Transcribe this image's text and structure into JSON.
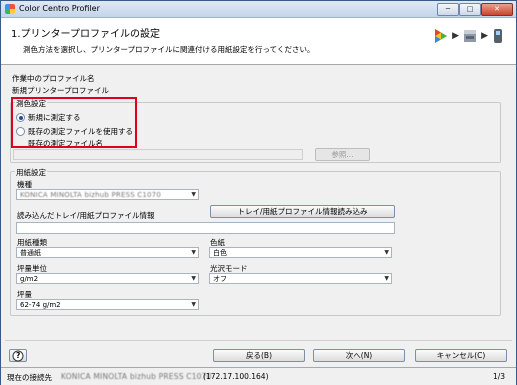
{
  "window": {
    "title": "Color Centro Profiler",
    "buttons": [
      "─",
      "□",
      "✕"
    ]
  },
  "header": {
    "title": "1.プリンタープロファイルの設定",
    "description": "測色方法を選択し、プリンタープロファイルに関連付ける用紙設定を行ってください。"
  },
  "profile": {
    "label": "作業中のプロファイル名",
    "name": "新規プリンタープロファイル"
  },
  "measure": {
    "title": "測色設定",
    "option_new": "新規に測定する",
    "option_existing": "既存の測定ファイルを使用する",
    "file_label": "既存の測定ファイル名",
    "file_value": "",
    "browse_label": "参照..."
  },
  "paper": {
    "title": "用紙設定",
    "model_label": "機種",
    "model_value": "KONICA MINOLTA bizhub PRESS C1070",
    "loaded_label": "読み込んだトレイ/用紙プロファイル情報",
    "load_button": "トレイ/用紙プロファイル情報読み込み",
    "loaded_value": "",
    "type_label": "用紙種類",
    "type_value": "普通紙",
    "color_label": "色紙",
    "color_value": "白色",
    "weight_unit_label": "坪量単位",
    "weight_unit_value": "g/m2",
    "gloss_label": "光沢モード",
    "gloss_value": "オフ",
    "weight_label": "坪量",
    "weight_value": "62-74 g/m2"
  },
  "footer": {
    "help_label": "?",
    "back_label": "戻る(B)",
    "next_label": "次へ(N)",
    "cancel_label": "キャンセル(C)"
  },
  "status": {
    "label": "現在の接続先",
    "device": "KONICA MINOLTA bizhub PRESS C1070",
    "address": "(172.17.100.164)",
    "page": "1/3"
  },
  "icons": [
    "app-icon",
    "color-cycle-icon",
    "printer-icon",
    "measure-device-icon"
  ]
}
